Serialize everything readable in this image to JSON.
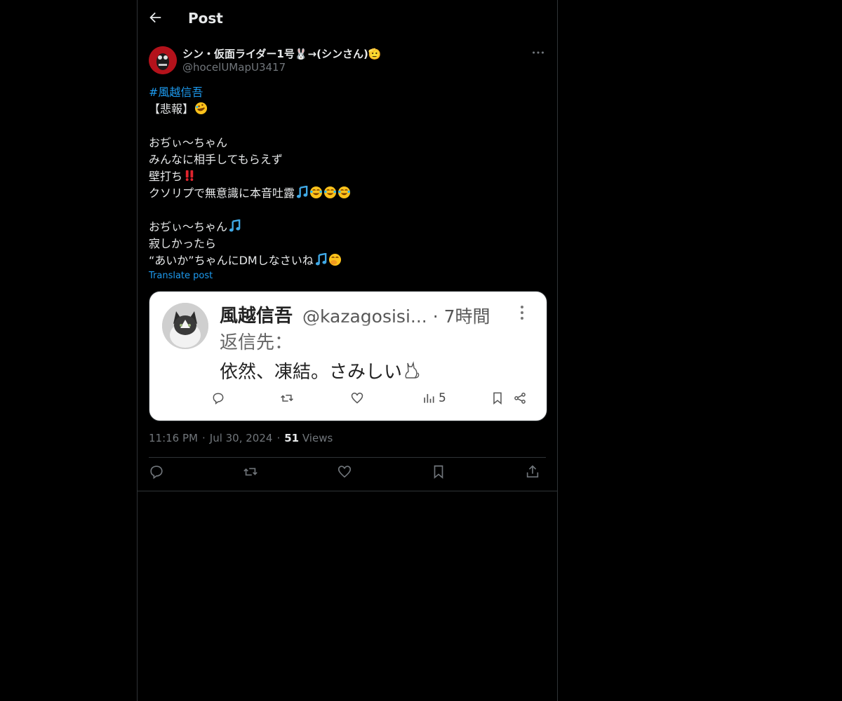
{
  "header": {
    "title": "Post"
  },
  "author": {
    "display_name": "シン・仮面ライダー1号🐰→(シンさん)🫡",
    "handle": "@hocelUMapU3417"
  },
  "tweet": {
    "hashtag": "#風越信吾",
    "lines": {
      "l1": "【悲報】",
      "l3": "おぢぃ〜ちゃん",
      "l4": "みんなに相手してもらえず",
      "l5": "壁打ち",
      "l6": "クソリプで無意識に本音吐露",
      "l8": "おぢぃ〜ちゃん",
      "l9": "寂しかったら",
      "l10": "“あいか”ちゃんにDMしなさいね"
    },
    "translate_label": "Translate post"
  },
  "embedded_screenshot": {
    "name": "風越信吾",
    "handle_time": "@kazagosisi... · 7時間",
    "reply_to": "返信先：",
    "body": "依然、凍結。さみしい",
    "views": "5"
  },
  "meta": {
    "time": "11:16 PM",
    "date": "Jul 30, 2024",
    "views_count": "51",
    "views_label": "Views",
    "separator": "·"
  },
  "icons": {
    "back": "arrow-left-icon",
    "more": "more-dots-icon",
    "reply": "reply-icon",
    "repost": "repost-icon",
    "like": "heart-icon",
    "bookmark": "bookmark-icon",
    "share": "share-icon"
  },
  "colors": {
    "background": "#000000",
    "text": "#e7e9ea",
    "secondary": "#71767b",
    "accent": "#1d9bf0",
    "border": "#2f3336"
  }
}
